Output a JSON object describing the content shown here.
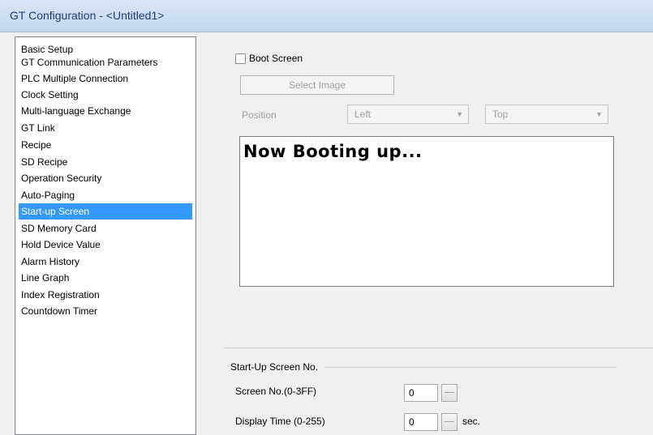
{
  "window": {
    "title": "GT Configuration - <Untitled1>"
  },
  "sidebar": {
    "items": [
      {
        "label": "Basic Setup"
      },
      {
        "label": "GT Communication Parameters"
      },
      {
        "label": "PLC Multiple Connection"
      },
      {
        "label": "Clock Setting"
      },
      {
        "label": "Multi-language Exchange"
      },
      {
        "label": "GT Link"
      },
      {
        "label": "Recipe"
      },
      {
        "label": "SD Recipe"
      },
      {
        "label": "Operation Security"
      },
      {
        "label": "Auto-Paging"
      },
      {
        "label": "Start-up Screen",
        "selected": true
      },
      {
        "label": "SD Memory Card"
      },
      {
        "label": "Hold Device Value"
      },
      {
        "label": "Alarm History"
      },
      {
        "label": "Line Graph"
      },
      {
        "label": "Index Registration"
      },
      {
        "label": "Countdown Timer"
      }
    ]
  },
  "boot": {
    "checkbox_label": "Boot Screen",
    "checked": false,
    "select_image_label": "Select Image",
    "position_label": "Position",
    "horizontal": "Left",
    "vertical": "Top",
    "message": "Now Booting up..."
  },
  "startup": {
    "group_title": "Start-Up Screen No.",
    "screen_no_label": "Screen No.(0-3FF)",
    "screen_no_value": "0",
    "display_time_label": "Display Time (0-255)",
    "display_time_value": "0",
    "display_time_unit": "sec."
  }
}
